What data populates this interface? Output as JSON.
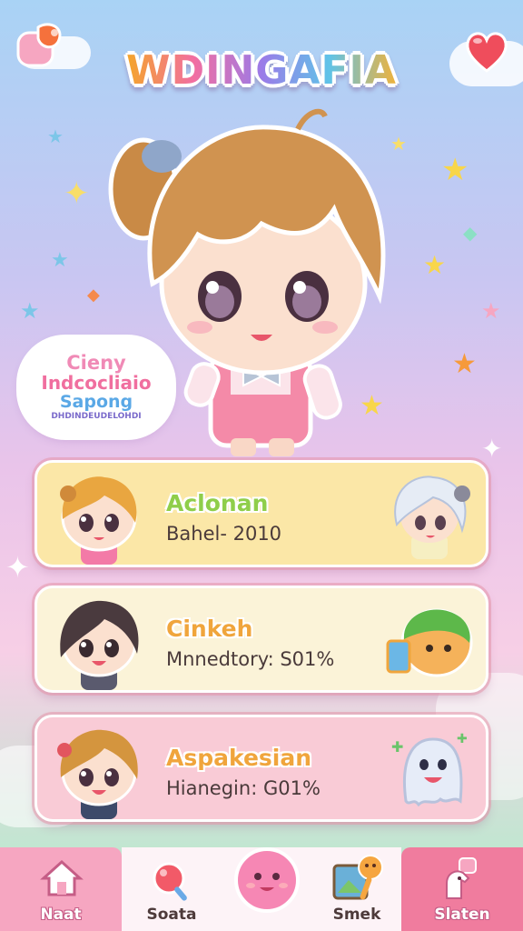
{
  "title": "WDINGAFIA",
  "bubble": {
    "line1": "Cieny",
    "line2": "Indcocliaio",
    "line3": "Sapong",
    "line4": "DHDINDEUDELOHDI"
  },
  "cards": [
    {
      "name": "Aclonan",
      "info": "Bahel- 2010",
      "bg": "#fbe7a7",
      "name_color": "#8fce4a"
    },
    {
      "name": "Cinkeh",
      "info": "Mnnedtory: S01%",
      "bg": "#fbf3d8",
      "name_color": "#f0a53c"
    },
    {
      "name": "Aspakesian",
      "info": "Hianegin: G01%",
      "bg": "#f9cbd6",
      "name_color": "#f0a53c"
    }
  ],
  "nav": [
    {
      "label": "Naat",
      "icon": "home-icon"
    },
    {
      "label": "Soata",
      "icon": "lollipop-icon"
    },
    {
      "label": "",
      "icon": "blob-character-icon"
    },
    {
      "label": "Smek",
      "icon": "photo-icon"
    },
    {
      "label": "Slaten",
      "icon": "unicorn-icon"
    }
  ],
  "colors": {
    "accent_pink": "#f37aa7",
    "accent_gold": "#f0a53c",
    "nav_pink": "#f6a6c1"
  }
}
